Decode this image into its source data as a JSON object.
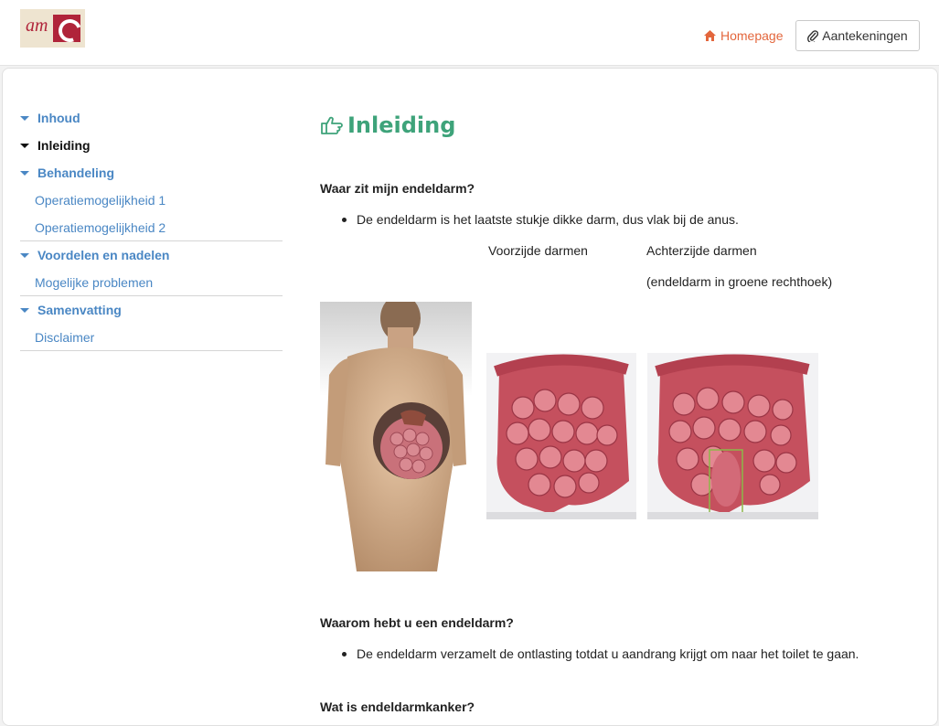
{
  "header": {
    "logo_text": "am",
    "home_label": "Homepage",
    "notes_label": "Aantekeningen"
  },
  "sidebar": {
    "sections": [
      {
        "label": "Inhoud"
      },
      {
        "label": "Inleiding"
      },
      {
        "label": "Behandeling"
      },
      {
        "label": "Voordelen en nadelen"
      },
      {
        "label": "Samenvatting"
      }
    ],
    "subitems": {
      "behandeling": [
        "Operatiemogelijkheid 1",
        "Operatiemogelijkheid 2"
      ],
      "voordelen": [
        "Mogelijke problemen"
      ],
      "samenvatting": [
        "Disclaimer"
      ]
    }
  },
  "content": {
    "title": "Inleiding",
    "q1": "Waar zit mijn endeldarm?",
    "a1": "De endeldarm is het laatste stukje dikke darm, dus vlak bij de anus.",
    "caption_front": "Voorzijde darmen",
    "caption_back": "Achterzijde darmen",
    "caption_back_note": "(endeldarm in groene rechthoek)",
    "q2": "Waarom hebt u een endeldarm?",
    "a2": "De endeldarm verzamelt de ontlasting totdat u aandrang krijgt om naar het toilet te gaan.",
    "q3": "Wat is endeldarmkanker?"
  },
  "colors": {
    "link": "#4a87c4",
    "accent_title": "#3ea37a",
    "home": "#e3663c",
    "highlight_box": "#8cb848"
  }
}
